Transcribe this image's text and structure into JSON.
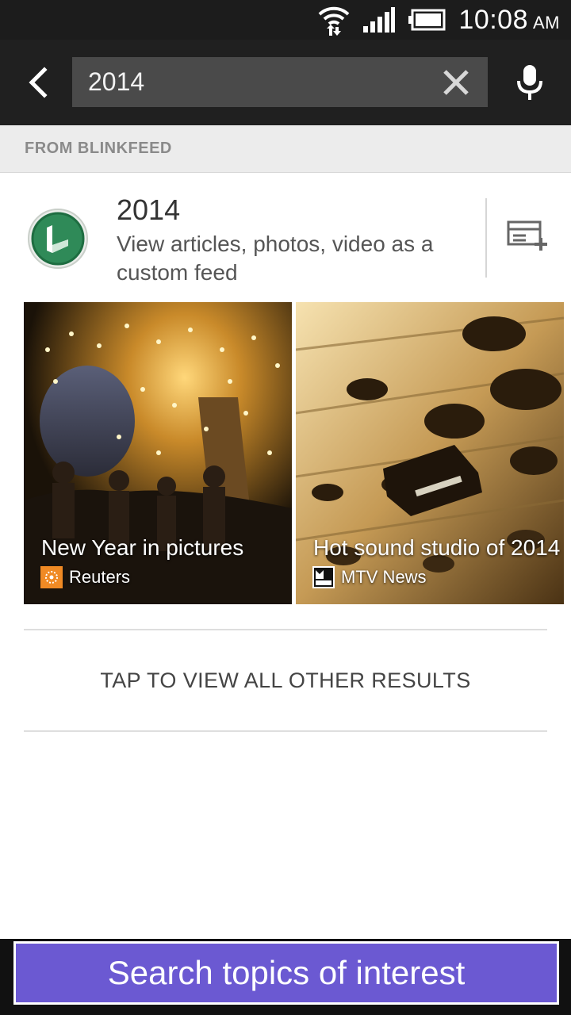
{
  "status_bar": {
    "time": "10:08",
    "ampm": "AM",
    "icons": [
      "wifi-icon",
      "signal-icon",
      "battery-icon"
    ]
  },
  "search": {
    "query": "2014",
    "icons": {
      "back": "back-arrow-icon",
      "clear": "clear-icon",
      "voice": "microphone-icon"
    }
  },
  "section": {
    "label": "FROM BLINKFEED"
  },
  "feed": {
    "title": "2014",
    "description": "View articles, photos, video as a custom feed",
    "logo_icon": "blinkfeed-logo-icon",
    "action_icon": "add-feed-icon"
  },
  "cards": [
    {
      "title": "New Year in pictures",
      "source": "Reuters",
      "source_icon": "reuters-logo-icon"
    },
    {
      "title": "Hot sound studio of 2014",
      "source": "MTV News",
      "source_icon": "mtv-news-logo-icon"
    }
  ],
  "view_all": {
    "label": "TAP TO VIEW ALL OTHER RESULTS"
  },
  "bottom_button": {
    "label": "Search topics of interest"
  },
  "colors": {
    "header_bg": "#202020",
    "search_box": "#4a4a4a",
    "accent_green": "#2e7d4f",
    "button_purple": "#6b59d2"
  }
}
